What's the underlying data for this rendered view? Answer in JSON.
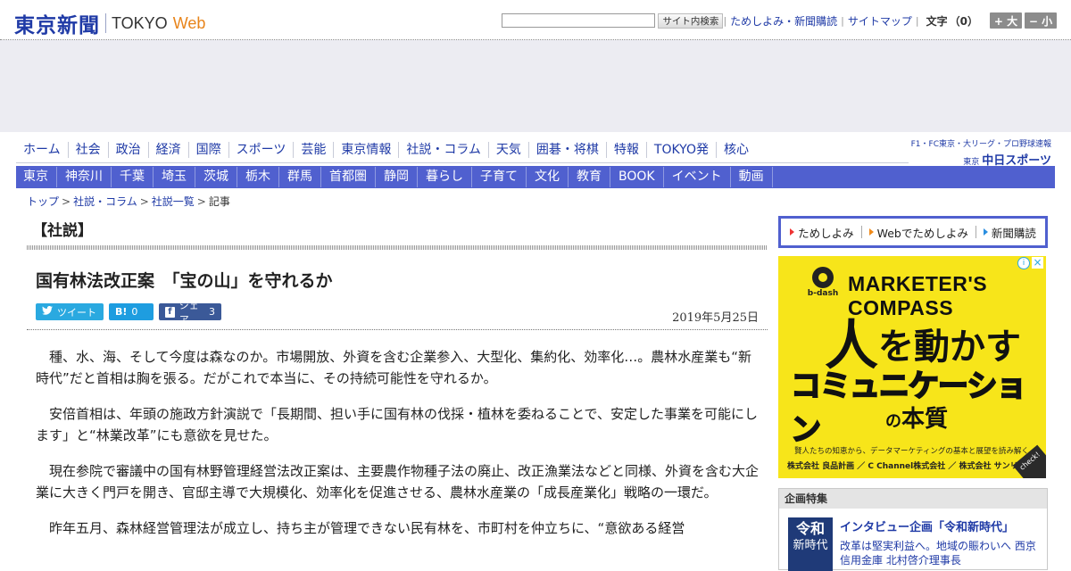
{
  "header": {
    "logo_kanji": "東京新聞",
    "logo_tokyo": "TOKYO",
    "logo_web": "Web",
    "search_button": "サイト内検索",
    "links": [
      "ためしよみ・新聞購読",
      "サイトマップ"
    ],
    "font_size_label": "文字",
    "font_size_value": "（0）",
    "font_bigger": "+ 大",
    "font_smaller": "− 小"
  },
  "main_nav": [
    "ホーム",
    "社会",
    "政治",
    "経済",
    "国際",
    "スポーツ",
    "芸能",
    "東京情報",
    "社説・コラム",
    "天気",
    "囲碁・将棋",
    "特報",
    "TOKYO発",
    "核心"
  ],
  "chunichi": {
    "tagline": "F1・FC東京・大リーグ・プロ野球速報",
    "prefix": "東京",
    "name": "中日スポーツ"
  },
  "region_nav": [
    "東京",
    "神奈川",
    "千葉",
    "埼玉",
    "茨城",
    "栃木",
    "群馬",
    "首都圏",
    "静岡",
    "暮らし",
    "子育て",
    "文化",
    "教育",
    "BOOK",
    "イベント",
    "動画"
  ],
  "breadcrumb": [
    "トップ",
    "社説・コラム",
    "社説一覧",
    "記事"
  ],
  "article": {
    "section_label": "【社説】",
    "title": "国有林法改正案　「宝の山」を守れるか",
    "date": "2019年5月25日",
    "share": {
      "tweet": "ツイート",
      "hatena_icon": "B!",
      "hatena_count": "0",
      "fb_icon": "f",
      "fb_label": "シェア",
      "fb_count": "3"
    },
    "paragraphs": [
      "種、水、海、そして今度は森なのか。市場開放、外資を含む企業参入、大型化、集約化、効率化…。農林水産業も“新時代”だと首相は胸を張る。だがこれで本当に、その持続可能性を守れるか。",
      "安倍首相は、年頭の施政方針演説で「長期間、担い手に国有林の伐採・植林を委ねることで、安定した事業を可能にします」と“林業改革”にも意欲を見せた。",
      "現在参院で審議中の国有林野管理経営法改正案は、主要農作物種子法の廃止、改正漁業法などと同様、外資を含む大企業に大きく門戸を開き、官邸主導で大規模化、効率化を促進させる、農林水産業の「成長産業化」戦略の一環だ。",
      "昨年五月、森林経営管理法が成立し、持ち主が管理できない民有林を、市町村を仲立ちに、“意欲ある経営"
    ]
  },
  "sidebar": {
    "subscribe": [
      "ためしよみ",
      "Webでためしよみ",
      "新聞購読"
    ],
    "subscribe_colors": [
      "#e33",
      "#f08a1a",
      "#2a8ee0"
    ],
    "ad": {
      "info_icon": "i",
      "close_icon": "×",
      "brand": "b-dash",
      "headline": "MARKETER'S COMPASS",
      "line1_big": "人",
      "line1_rest": "を動かす",
      "line2": "コミュニケーション",
      "line3_no": "の",
      "line3_rest": "本質",
      "sub": "賢人たちの知恵から、データマーケティングの基本と展望を読み解く",
      "sponsors": "株式会社 良品計画 ／ C Channel株式会社 ／ 株式会社 サンリオ",
      "check": "check!"
    },
    "feature": {
      "heading": "企画特集",
      "thumb_line1": "令和",
      "thumb_line2": "新時代",
      "title": "インタビュー企画「令和新時代」",
      "desc": "改革は堅実利益へ。地域の賑わいへ 西京信用金庫 北村啓介理事長"
    }
  }
}
